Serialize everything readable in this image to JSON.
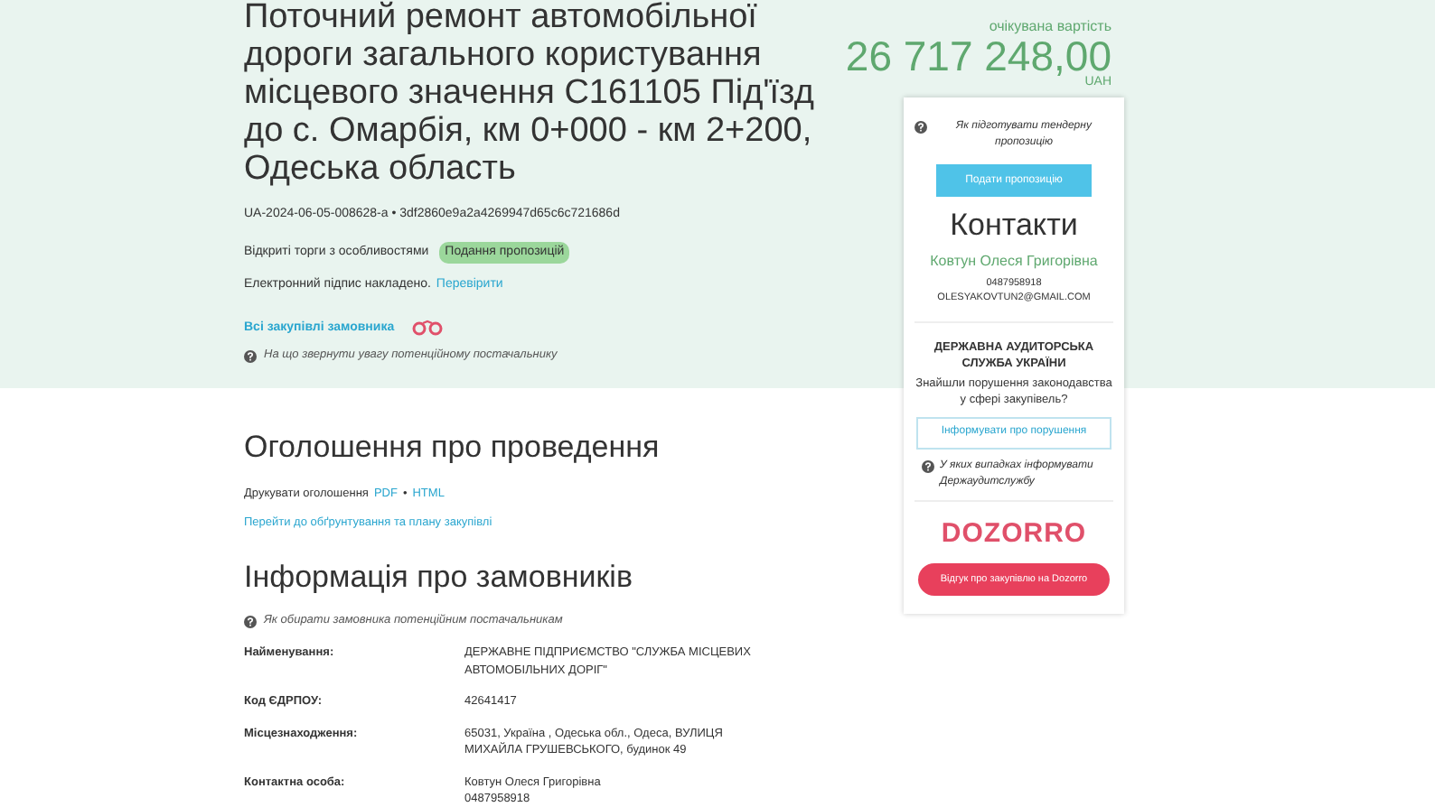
{
  "tender": {
    "title": "Поточний ремонт автомобільної дороги загального користування місцевого значення С161105 Під'їзд до с. Омарбія, км 0+000 - км 2+200, Одеська область",
    "id_line": "UA-2024-06-05-008628-a • 3df2860e9a2a4269947d65c6c721686d",
    "procedure": "Відкриті торги з особливостями",
    "status": "Подання пропозицій",
    "signature": "Електронний підпис накладено.",
    "signature_link": "Перевірити",
    "buyer_link": "Всі закупівлі замовника",
    "hint": "На що звернути увагу потенційному постачальнику"
  },
  "value": {
    "label": "очікувана вартість",
    "amount": "26 717 248,00",
    "currency": "UAH"
  },
  "sidebar": {
    "hint": "Як підготувати тендерну пропозицію",
    "submit": "Подати пропозицію",
    "contacts_title": "Контакти",
    "contact_name": "Ковтун Олеся Григорівна",
    "contact_phone": "0487958918",
    "contact_email": "OLESYAKOVTUN2@GMAIL.COM",
    "audit_title": "ДЕРЖАВНА АУДИТОРСЬКА СЛУЖБА УКРАЇНИ",
    "audit_question": "Знайшли порушення законодавства у сфері закупівель?",
    "audit_button": "Інформувати про порушення",
    "audit_hint": "У яких випадках інформувати Держаудитслужбу",
    "logo": "DOZORRO",
    "feedback_button": "Відгук про закупівлю на Dozorro"
  },
  "announcement": {
    "title": "Оголошення про проведення",
    "print_label": "Друкувати оголошення",
    "print_pdf": "PDF",
    "print_separator": "•",
    "print_html": "HTML",
    "plan_link": "Перейти до обґрунтування та плану закупівлі"
  },
  "buyer": {
    "title": "Інформація про замовників",
    "hint": "Як обирати замовника потенційним постачальникам",
    "rows": [
      {
        "label": "Найменування:",
        "value": "ДЕРЖАВНЕ ПІДПРИЄМСТВО \"СЛУЖБА МІСЦЕВИХ АВТОМОБІЛЬНИХ ДОРІГ\""
      },
      {
        "label": "Код ЄДРПОУ:",
        "value": "42641417"
      },
      {
        "label": "Місцезнаходження:",
        "value": "65031, Україна , Одеська обл., Одеса, ВУЛИЦЯ МИХАЙЛА ГРУШЕВСЬКОГО, будинок 49"
      },
      {
        "label": "Контактна особа:",
        "value": "Ковтун Олеся Григорівна\n0487958918"
      }
    ]
  }
}
